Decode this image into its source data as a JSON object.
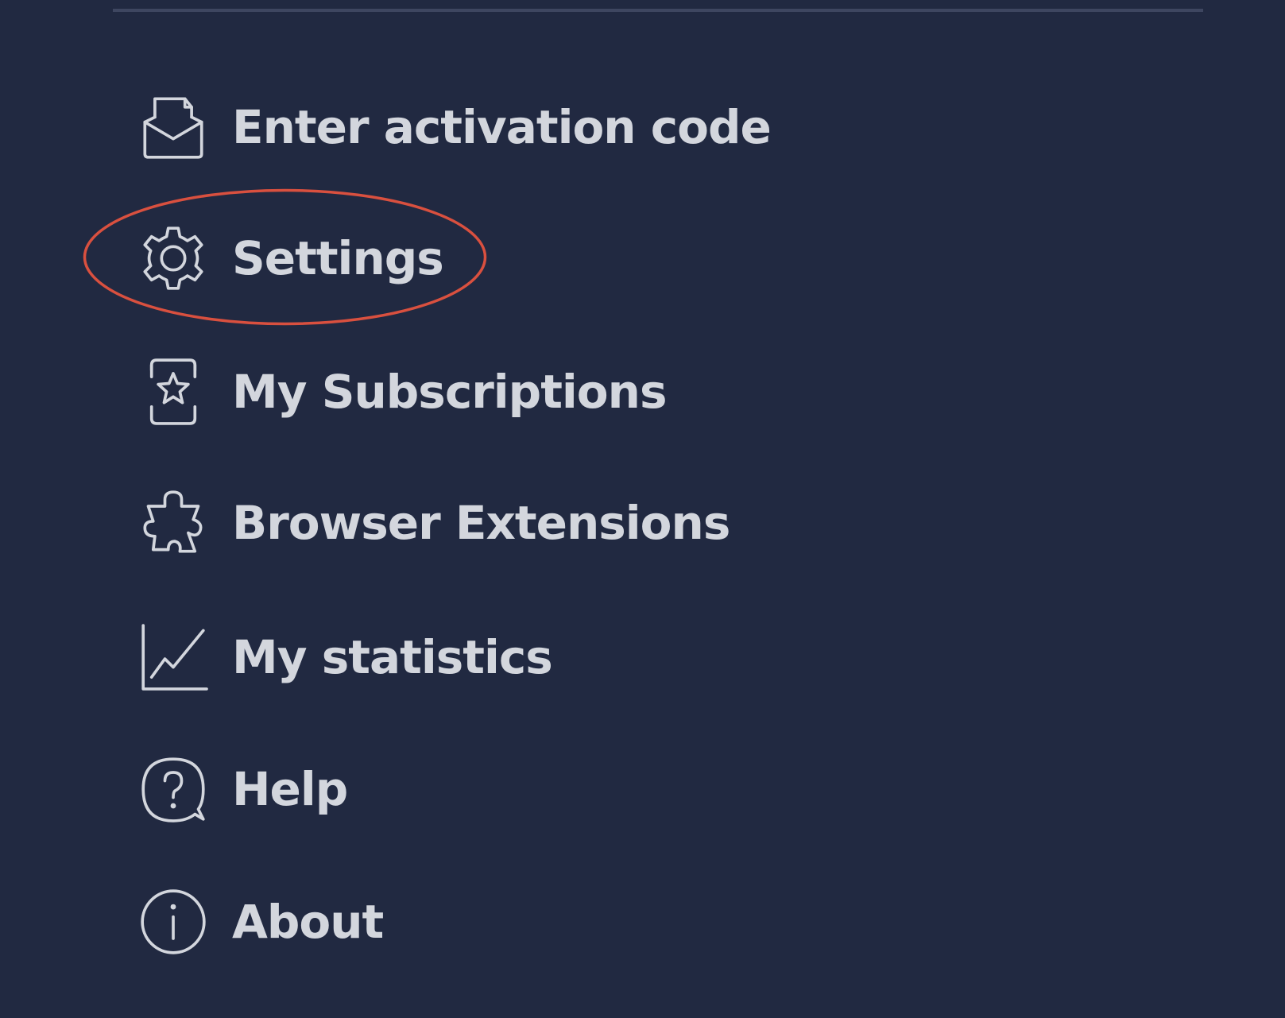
{
  "menu": {
    "items": [
      {
        "id": "activation",
        "label": "Enter activation code",
        "icon": "envelope-open-icon"
      },
      {
        "id": "settings",
        "label": "Settings",
        "icon": "gear-icon"
      },
      {
        "id": "subscriptions",
        "label": "My Subscriptions",
        "icon": "subscription-star-icon"
      },
      {
        "id": "extensions",
        "label": "Browser Extensions",
        "icon": "puzzle-piece-icon"
      },
      {
        "id": "statistics",
        "label": "My statistics",
        "icon": "line-chart-icon"
      },
      {
        "id": "help",
        "label": "Help",
        "icon": "question-bubble-icon"
      },
      {
        "id": "about",
        "label": "About",
        "icon": "info-circle-icon"
      }
    ]
  },
  "colors": {
    "background": "#212941",
    "text": "#d3d6dd",
    "icon_stroke": "#d3d6dd",
    "divider": "#3e4660",
    "highlight": "#d9503f"
  }
}
